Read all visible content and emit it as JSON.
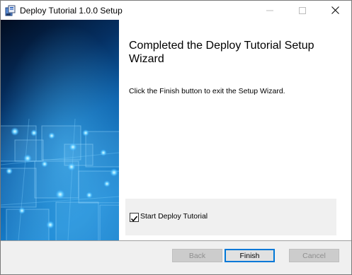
{
  "window": {
    "title": "Deploy Tutorial 1.0.0 Setup"
  },
  "controls": {
    "minimize": "—",
    "maximize": "☐",
    "close": "✕"
  },
  "page": {
    "heading": "Completed the Deploy Tutorial Setup Wizard",
    "description": "Click the Finish button to exit the Setup Wizard."
  },
  "launch": {
    "label": "Start Deploy Tutorial",
    "checked": true
  },
  "buttons": {
    "back": "Back",
    "finish": "Finish",
    "cancel": "Cancel"
  },
  "colors": {
    "accent": "#0078d7",
    "banner_dark": "#031633",
    "banner_light": "#1f8ad1"
  }
}
